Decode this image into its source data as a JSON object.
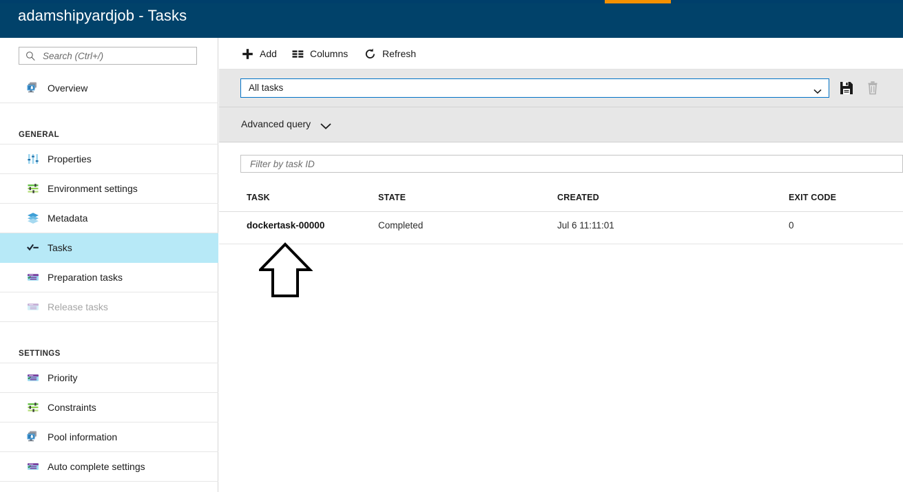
{
  "header": {
    "title": "adamshipyardjob - Tasks",
    "bg_color": "#01426a",
    "progress_color": "#f59000"
  },
  "sidebar": {
    "search": {
      "placeholder": "Search (Ctrl+/)",
      "value": "",
      "icon": "search-icon"
    },
    "items": [
      {
        "label": "Overview",
        "icon": "overview-monitor-icon",
        "selected": false,
        "disabled": false
      },
      {
        "label": "Properties",
        "icon": "sliders-icon",
        "selected": false,
        "disabled": false
      },
      {
        "label": "Environment settings",
        "icon": "settings-sliders-icon",
        "selected": false,
        "disabled": false
      },
      {
        "label": "Metadata",
        "icon": "layers-icon",
        "selected": false,
        "disabled": false
      },
      {
        "label": "Tasks",
        "icon": "check-task-icon",
        "selected": true,
        "disabled": false
      },
      {
        "label": "Preparation tasks",
        "icon": "task-card-icon",
        "selected": false,
        "disabled": false
      },
      {
        "label": "Release tasks",
        "icon": "task-card-icon",
        "selected": false,
        "disabled": true
      },
      {
        "label": "Priority",
        "icon": "task-card-icon",
        "selected": false,
        "disabled": false
      },
      {
        "label": "Constraints",
        "icon": "settings-sliders-icon",
        "selected": false,
        "disabled": false
      },
      {
        "label": "Pool information",
        "icon": "overview-monitor-icon",
        "selected": false,
        "disabled": false
      },
      {
        "label": "Auto complete settings",
        "icon": "task-card-icon",
        "selected": false,
        "disabled": false
      }
    ],
    "groups": {
      "general": "GENERAL",
      "settings": "SETTINGS"
    },
    "selected_bg": "#b7e9f7"
  },
  "toolbar": {
    "add_label": "Add",
    "add_icon": "plus-icon",
    "columns_label": "Columns",
    "columns_icon": "columns-icon",
    "refresh_label": "Refresh",
    "refresh_icon": "refresh-icon"
  },
  "query": {
    "selected": "All tasks",
    "dropdown_icon": "chevron-down-icon",
    "save_icon": "save-disk-icon",
    "delete_icon": "trash-icon",
    "border_color": "#0072c6"
  },
  "advanced_query": {
    "label": "Advanced query",
    "icon": "chevron-down-icon",
    "expanded": false
  },
  "filter": {
    "placeholder": "Filter by task ID",
    "value": ""
  },
  "table": {
    "columns": [
      "TASK",
      "STATE",
      "CREATED",
      "EXIT CODE"
    ],
    "rows": [
      {
        "task": "dockertask-00000",
        "state": "Completed",
        "created": "Jul 6 11:11:01",
        "exit_code": "0"
      }
    ]
  },
  "annotation": {
    "arrow": "up-arrow-annotation",
    "color": "#000000"
  }
}
